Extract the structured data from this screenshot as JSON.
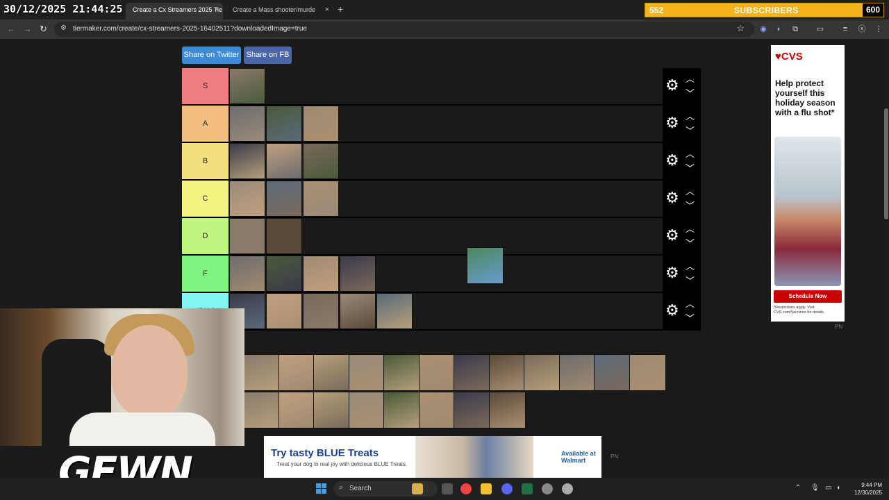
{
  "browser": {
    "clock_overlay": "30/12/2025 21:44:25",
    "tabs": [
      {
        "label": "Create a Cx Streamers 2025 Tie",
        "active": true
      },
      {
        "label": "Create a Mass shooter/murde",
        "active": false
      }
    ],
    "new_tab": "+",
    "close": "×",
    "url": "tiermaker.com/create/cx-streamers-2025-16402511?downloadedImage=true"
  },
  "subscriber_goal": {
    "count": "552",
    "label": "SUBSCRIBERS",
    "goal": "600"
  },
  "page": {
    "share_twitter": "Share on Twitter",
    "share_fb": "Share on FB",
    "tiers": [
      {
        "label": "S",
        "color": "#f07d7f",
        "items": 1
      },
      {
        "label": "A",
        "color": "#f3bf80",
        "items": 3
      },
      {
        "label": "B",
        "color": "#f3df80",
        "items": 3
      },
      {
        "label": "C",
        "color": "#f4f580",
        "items": 3
      },
      {
        "label": "D",
        "color": "#c0f57f",
        "items": 2
      },
      {
        "label": "F",
        "color": "#7ff47f",
        "items": 4
      },
      {
        "label": "IDK /",
        "color": "#7ff5f4",
        "items": 5
      }
    ],
    "pool_count": 20
  },
  "ads": {
    "side": {
      "brand": "♥CVS",
      "headline": "Help protect yourself this holiday season with a flu shot*",
      "cta": "Schedule Now",
      "fine_print": "*Restrictions apply. Visit CVS.com/Vaccines for details."
    },
    "bottom": {
      "title": "Try tasty BLUE Treats",
      "subtitle": "Treat your dog to real joy with delicious BLUE Treats.",
      "retailer": "Available at Walmart"
    },
    "pn": "PN"
  },
  "overlay": {
    "logo": "GEWN"
  },
  "taskbar": {
    "search": "Search",
    "time": "9:44 PM",
    "date": "12/30/2025"
  }
}
